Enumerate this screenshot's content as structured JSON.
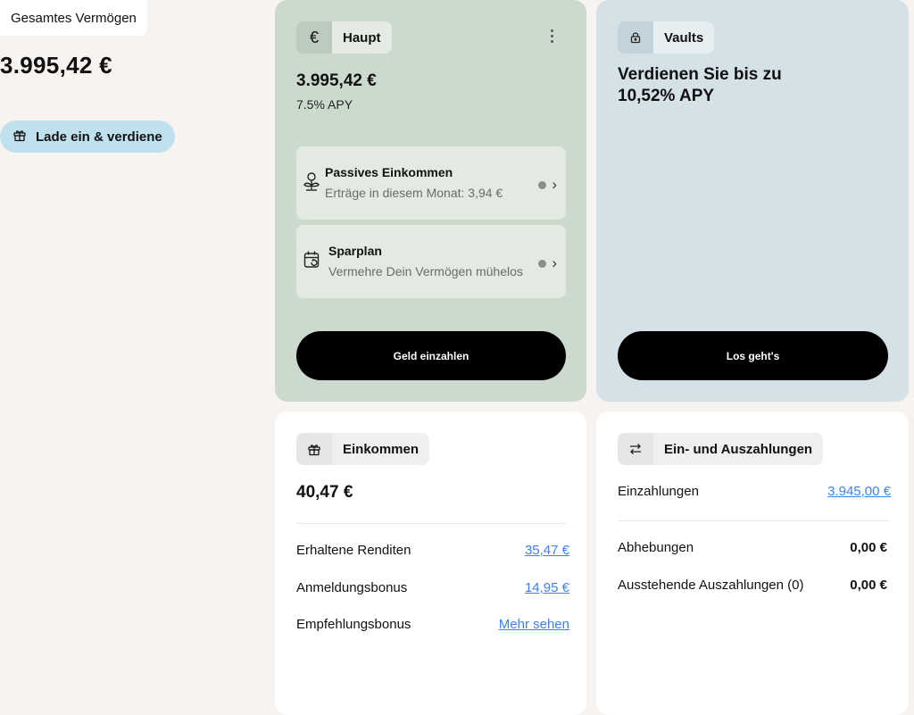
{
  "overview": {
    "total_label": "Gesamtes Vermögen",
    "total_value": "3.995,42 €",
    "invite_label": "Lade ein & verdiene"
  },
  "main_account": {
    "tab_label": "Haupt",
    "currency_symbol": "€",
    "balance": "3.995,42 €",
    "apy": "7.5% APY",
    "passive": {
      "title": "Passives Einkommen",
      "subtitle": "Erträge in diesem Monat: 3,94 €"
    },
    "savings_plan": {
      "title": "Sparplan",
      "subtitle": "Vermehre Dein Vermögen mühelos"
    },
    "deposit_button": "Geld einzahlen"
  },
  "vaults": {
    "tab_label": "Vaults",
    "headline": "Verdienen Sie bis zu 10,52% APY",
    "cta_button": "Los geht's"
  },
  "income": {
    "tab_label": "Einkommen",
    "total": "40,47 €",
    "rows": [
      {
        "label": "Erhaltene Renditen",
        "value": "35,47 €"
      },
      {
        "label": "Anmeldungsbonus",
        "value": "14,95 €"
      },
      {
        "label": "Empfehlungsbonus",
        "value": "Mehr sehen"
      }
    ]
  },
  "flows": {
    "tab_label": "Ein- und Auszahlungen",
    "deposits": {
      "label": "Einzahlungen",
      "value": "3.945,00 €"
    },
    "withdrawals": {
      "label": "Abhebungen",
      "value": "0,00 €"
    },
    "pending": {
      "label": "Ausstehende Auszahlungen (0)",
      "value": "0,00 €"
    }
  },
  "colors": {
    "main_card": "#ccdacd",
    "vault_card": "#d4e1e7",
    "invite_button": "#bfe1ee",
    "link": "#3b82f6"
  }
}
